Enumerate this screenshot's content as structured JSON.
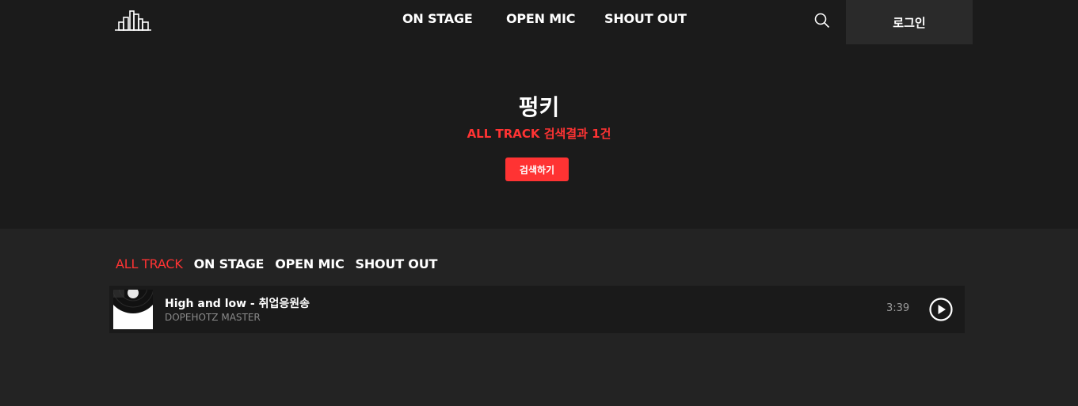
{
  "header": {
    "nav": [
      "ON STAGE",
      "OPEN MIC",
      "SHOUT OUT"
    ],
    "login_label": "로그인"
  },
  "hero": {
    "title": "펑키",
    "subtitle": "ALL TRACK 검색결과 1건",
    "button_label": "검색하기"
  },
  "tabs": [
    {
      "label": "ALL TRACK",
      "active": true
    },
    {
      "label": "ON STAGE",
      "active": false
    },
    {
      "label": "OPEN MIC",
      "active": false
    },
    {
      "label": "SHOUT OUT",
      "active": false
    }
  ],
  "tracks": [
    {
      "title": "High and low - 취업응원송",
      "artist": "DOPEHOTZ MASTER",
      "duration": "3:39"
    }
  ],
  "colors": {
    "accent": "#ff3333",
    "background_top": "#1b1b1b",
    "background_bottom": "#232323"
  },
  "icons": {
    "logo": "city-skyline-logo",
    "search": "search-icon",
    "play": "play-circle-icon"
  }
}
